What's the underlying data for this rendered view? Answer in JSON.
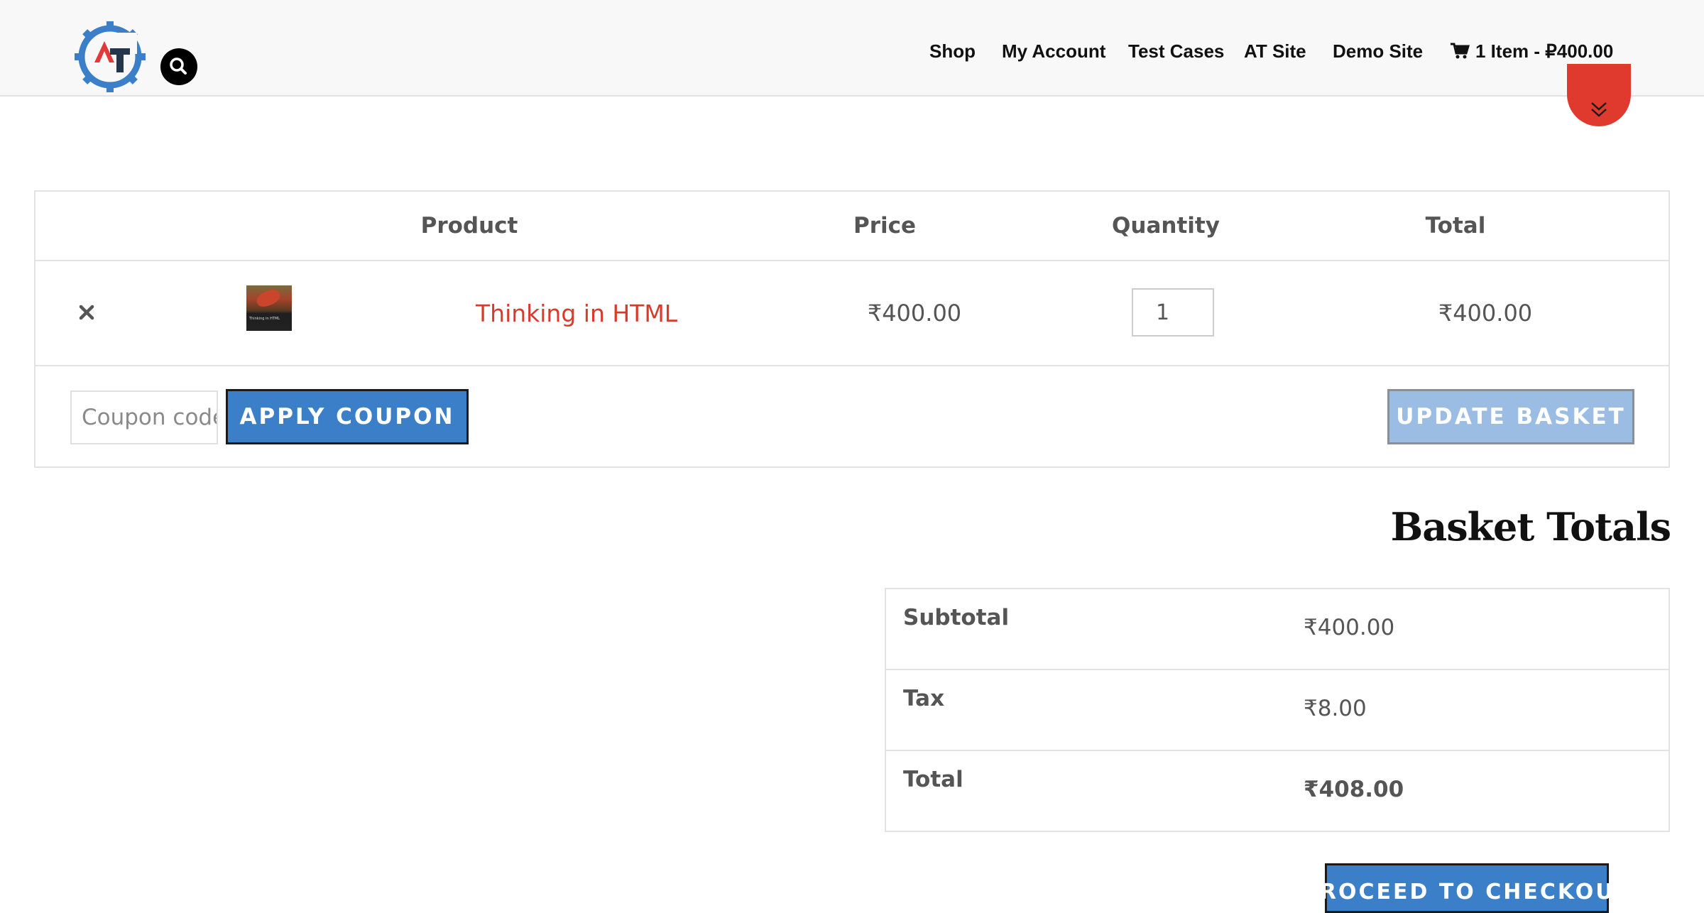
{
  "header": {
    "logo_text": "AT",
    "nav": [
      {
        "label": "Shop"
      },
      {
        "label": "My Account"
      },
      {
        "label": "Test Cases"
      },
      {
        "label": "AT Site"
      },
      {
        "label": "Demo Site"
      }
    ],
    "cart": {
      "label": "1 Item - ₽400.00"
    }
  },
  "cart_table": {
    "headers": [
      "Product",
      "Price",
      "Quantity",
      "Total"
    ],
    "rows": [
      {
        "remove_label": "×",
        "thumbnail_title": "Thinking in HTML",
        "product_name": "Thinking in HTML",
        "price": "₹400.00",
        "quantity": "1",
        "total": "₹400.00"
      }
    ],
    "coupon_placeholder": "Coupon code",
    "apply_coupon_label": "APPLY COUPON",
    "update_basket_label": "UPDATE BASKET"
  },
  "totals": {
    "heading": "Basket Totals",
    "rows": [
      {
        "label": "Subtotal",
        "value": "₹400.00"
      },
      {
        "label": "Tax",
        "value": "₹8.00"
      },
      {
        "label": "Total",
        "value": "₹408.00"
      }
    ],
    "checkout_label": "PROCEED TO CHECKOUT"
  },
  "colors": {
    "accent_blue": "#3a7fc8",
    "product_link": "#d83a2b",
    "scroll_badge": "#e03a2f"
  }
}
